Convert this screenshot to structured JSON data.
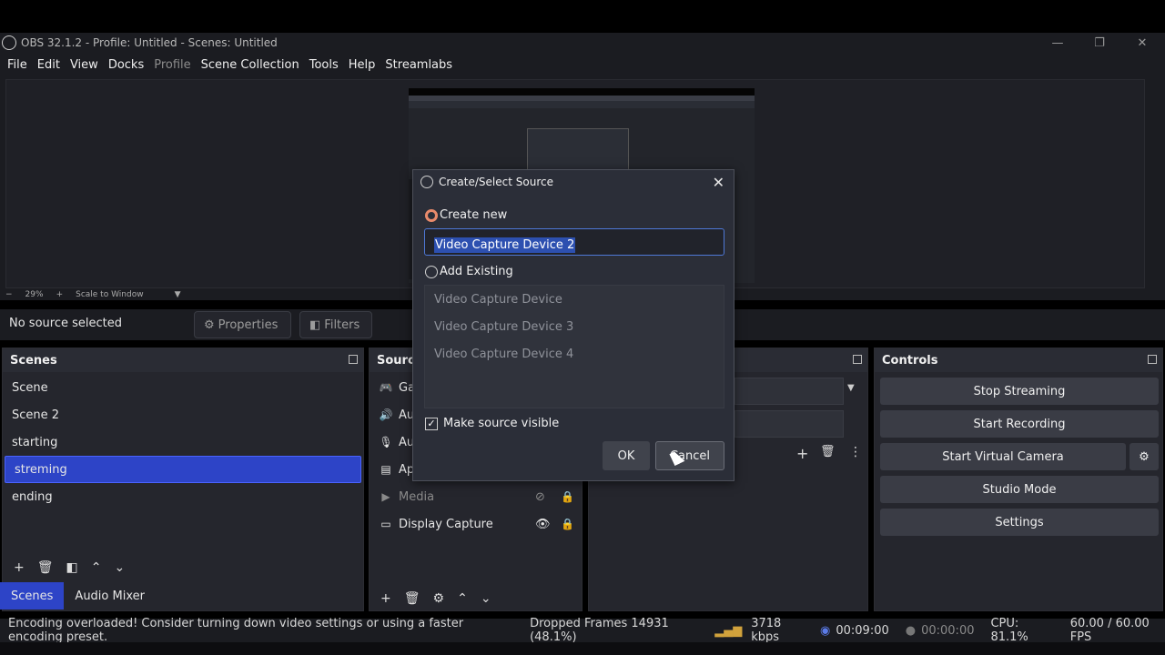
{
  "window": {
    "title": "OBS 32.1.2 - Profile: Untitled - Scenes: Untitled",
    "controls": {
      "minimize": "—",
      "restore": "❐",
      "close": "✕"
    }
  },
  "menu": {
    "items": [
      "File",
      "Edit",
      "View",
      "Docks",
      "Profile",
      "Scene Collection",
      "Tools",
      "Help",
      "Streamlabs"
    ]
  },
  "preview": {
    "zoom": "29%",
    "scale_mode": "Scale to Window",
    "minus": "−",
    "plus": "+"
  },
  "source_toolbar": {
    "no_source": "No source selected",
    "properties": "Properties",
    "filters": "Filters"
  },
  "scenes_dock": {
    "title": "Scenes",
    "items": [
      "Scene",
      "Scene 2",
      "starting",
      "streming",
      "ending"
    ],
    "selected_index": 3
  },
  "sources_dock": {
    "title": "Source",
    "items": [
      {
        "icon": "gamepad-icon",
        "label": "Ga"
      },
      {
        "icon": "speaker-icon",
        "label": "Au"
      },
      {
        "icon": "microphone-icon",
        "label": "Au"
      },
      {
        "icon": "app-icon",
        "label": "Ap"
      },
      {
        "icon": "play-icon",
        "label": "Media"
      },
      {
        "icon": "monitor-icon",
        "label": "Display Capture"
      }
    ]
  },
  "controls_dock": {
    "title": "Controls",
    "stop_streaming": "Stop Streaming",
    "start_recording": "Start Recording",
    "start_virtual_camera": "Start Virtual Camera",
    "studio_mode": "Studio Mode",
    "settings": "Settings"
  },
  "bottom_tabs": {
    "scenes": "Scenes",
    "audio_mixer": "Audio Mixer"
  },
  "status": {
    "message": "Encoding overloaded! Consider turning down video settings or using a faster encoding preset.",
    "dropped_frames": "Dropped Frames 14931 (48.1%)",
    "bitrate": "3718 kbps",
    "stream_time": "00:09:00",
    "rec_time": "00:00:00",
    "cpu": "CPU: 81.1%",
    "fps": "60.00 / 60.00 FPS"
  },
  "dialog": {
    "title": "Create/Select Source",
    "create_new": "Create new",
    "name_value": "Video Capture Device 2",
    "add_existing": "Add Existing",
    "existing": [
      "Video Capture Device",
      "Video Capture Device 3",
      "Video Capture Device 4"
    ],
    "make_visible": "Make source visible",
    "ok": "OK",
    "cancel": "Cancel"
  },
  "colors": {
    "accent": "#2d44c7",
    "radio_on": "#e88a6b",
    "panel": "#25262d",
    "background": "#1b1c21"
  }
}
